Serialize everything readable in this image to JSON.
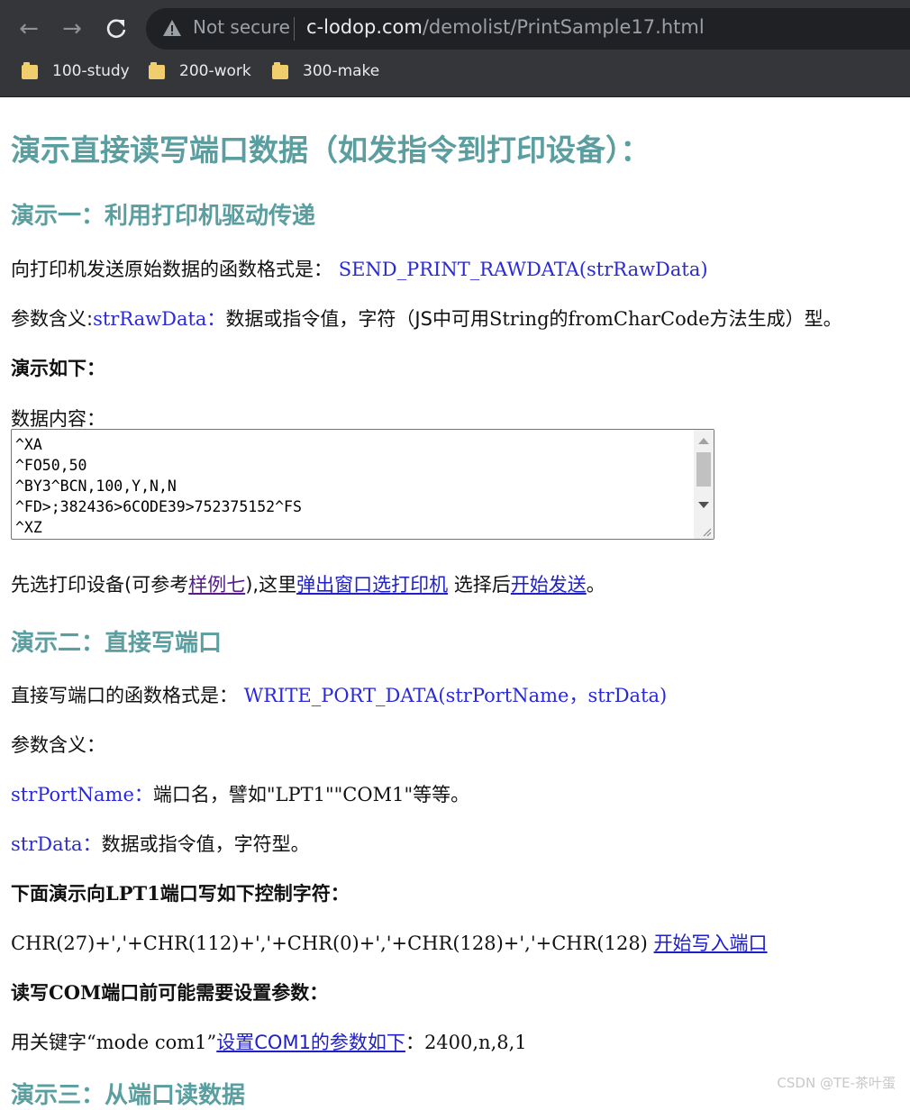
{
  "browser": {
    "security_label": "Not secure",
    "url_host": "c-lodop.com",
    "url_path": "/demolist/PrintSample17.html",
    "bookmarks": [
      {
        "label": "100-study"
      },
      {
        "label": "200-work"
      },
      {
        "label": "300-make"
      }
    ]
  },
  "page": {
    "title": "演示直接读写端口数据（如发指令到打印设备）：",
    "demo1": {
      "heading": "演示一：利用打印机驱动传递",
      "func_prefix": "向打印机发送原始数据的函数格式是：",
      "func_sig": "SEND_PRINT_RAWDATA(strRawData)",
      "param_prefix": "参数含义:",
      "param_name": "strRawData：",
      "param_desc_a": "数据或指令值，字符（JS中可用",
      "param_desc_b": "String",
      "param_desc_c": "的",
      "param_desc_d": "fromCharCode",
      "param_desc_e": "方法生成）型。",
      "demo_label": "演示如下：",
      "data_label": "数据内容：",
      "textarea_lines": [
        "^XA",
        "^FO50,50",
        "^BY3^BCN,100,Y,N,N",
        "^FD>;382436>6CODE39>752375152^FS",
        "^XZ"
      ],
      "select_a": "先选打印设备(可参考",
      "link_sample": "样例七",
      "select_b": "),这里",
      "link_popup": "弹出窗口选打印机",
      "select_c": " 选择后",
      "link_start": "开始发送",
      "select_d": "。"
    },
    "demo2": {
      "heading": "演示二：直接写端口",
      "func_prefix": "直接写端口的函数格式是：",
      "func_sig": "WRITE_PORT_DATA(strPortName，strData)",
      "param_label": "参数含义：",
      "p1_name": "strPortName：",
      "p1_desc_a": "端口名，譬如",
      "p1_desc_b": "\"LPT1\"\"COM1\"",
      "p1_desc_c": "等等。",
      "p2_name": "strData：",
      "p2_desc": "数据或指令值，字符型。",
      "lpt_heading_a": "下面演示向",
      "lpt_heading_b": "LPT1",
      "lpt_heading_c": "端口写如下控制字符：",
      "chr_seq": "CHR(27)+','+CHR(112)+','+CHR(0)+','+CHR(128)+','+CHR(128) ",
      "link_write": "开始写入端口",
      "com_heading_a": "读写",
      "com_heading_b": "COM",
      "com_heading_c": "端口前可能需要设置参数：",
      "mode_a": "用关键字",
      "mode_b": "“mode com1”",
      "link_com": "设置COM1的参数如下",
      "mode_c": "：",
      "mode_d": "2400,n,8,1"
    },
    "demo3": {
      "heading": "演示三：从端口读数据"
    }
  },
  "watermark": "CSDN @TE-茶叶蛋"
}
